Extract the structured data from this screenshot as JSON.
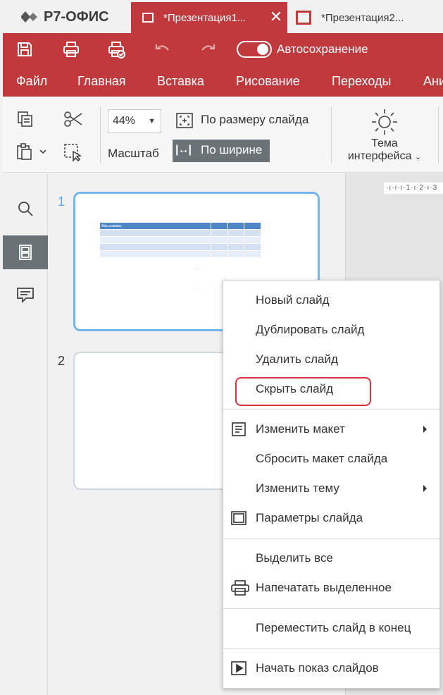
{
  "app": {
    "logo_text": "Р7-ОФИС"
  },
  "tabs": [
    {
      "label": "*Презентация1...",
      "active": true
    },
    {
      "label": "*Презентация2..."
    }
  ],
  "quickbar": {
    "autosave_label": "Автосохранение"
  },
  "menu": [
    "Файл",
    "Главная",
    "Вставка",
    "Рисование",
    "Переходы",
    "Ани"
  ],
  "ribbon": {
    "zoom_value": "44%",
    "zoom_label": "Масштаб",
    "fit_slide": "По размеру слайда",
    "fit_width": "По ширине",
    "fit_width_icon": "|↔|",
    "theme_label_1": "Тема",
    "theme_label_2": "интерфейса"
  },
  "slides": [
    {
      "num": "1",
      "table_header": "Ава  шававы"
    },
    {
      "num": "2"
    }
  ],
  "ruler_text": "·ı·ı·ı·1·ı·2·ı·3",
  "context_menu": {
    "new_slide": "Новый слайд",
    "duplicate_slide": "Дублировать слайд",
    "delete_slide": "Удалить слайд",
    "hide_slide": "Скрыть слайд",
    "change_layout": "Изменить макет",
    "reset_layout": "Сбросить макет слайда",
    "change_theme": "Изменить тему",
    "slide_settings": "Параметры слайда",
    "select_all": "Выделить все",
    "print_selection": "Напечатать выделенное",
    "move_to_end": "Переместить слайд в конец",
    "start_slideshow": "Начать показ слайдов"
  },
  "colors": {
    "accent": "#c0393d",
    "selection": "#76b5ef",
    "highlight": "#d8323c"
  }
}
